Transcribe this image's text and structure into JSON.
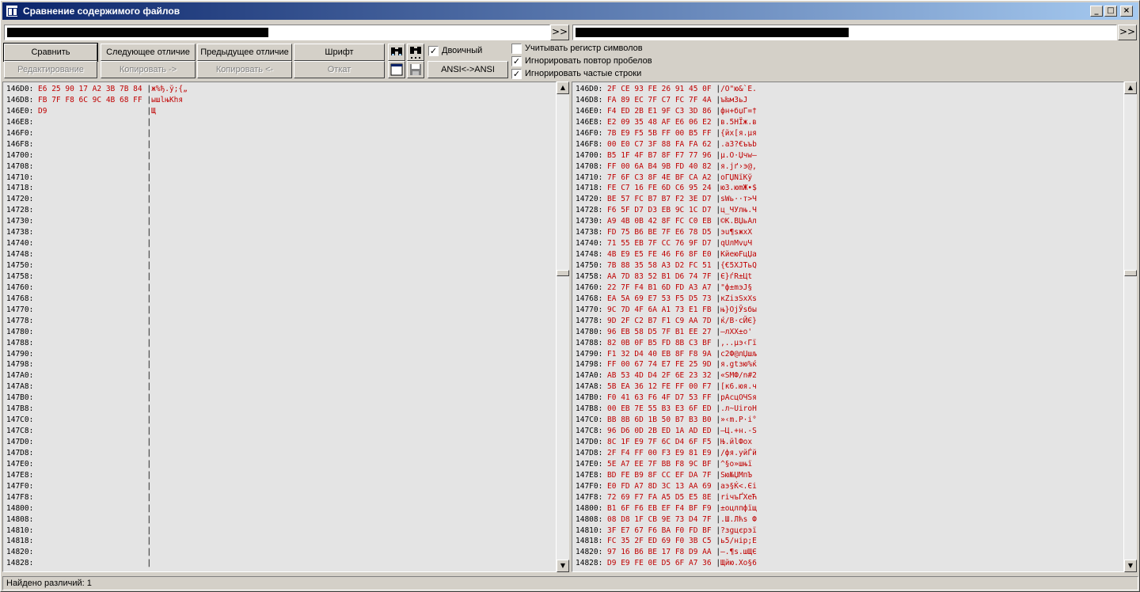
{
  "window": {
    "title": "Сравнение содержимого файлов",
    "minimize": "_",
    "maximize": "□",
    "close": "×"
  },
  "paths": {
    "go_label": ">>"
  },
  "toolbar": {
    "compare": "Сравнить",
    "next_diff": "Следующее отличие",
    "prev_diff": "Предыдущее отличие",
    "font": "Шрифт",
    "edit": "Редактирование",
    "copy_right": "Копировать ->",
    "copy_left": "Копировать <-",
    "rollback": "Откат",
    "encoding": "ANSI<->ANSI",
    "binary": "Двоичный",
    "binary_checked": true
  },
  "options": [
    {
      "label": "Учитывать регистр символов",
      "checked": false
    },
    {
      "label": "Игнорировать повтор пробелов",
      "checked": true
    },
    {
      "label": "Игнорировать частые строки",
      "checked": true
    }
  ],
  "left_pane": [
    {
      "addr": "146D0:",
      "hex": "E6 25 90 17 A2 3B 7B 84",
      "text": "ж%ђ.ў;{„"
    },
    {
      "addr": "146D8:",
      "hex": "FB 7F F8 6C 9C 4B 68 FF",
      "text": "ышlњKhя"
    },
    {
      "addr": "146E0:",
      "hex": "D9",
      "text": "Щ"
    },
    {
      "addr": "146E8:",
      "hex": "",
      "text": ""
    },
    {
      "addr": "146F0:",
      "hex": "",
      "text": ""
    },
    {
      "addr": "146F8:",
      "hex": "",
      "text": ""
    },
    {
      "addr": "14700:",
      "hex": "",
      "text": ""
    },
    {
      "addr": "14708:",
      "hex": "",
      "text": ""
    },
    {
      "addr": "14710:",
      "hex": "",
      "text": ""
    },
    {
      "addr": "14718:",
      "hex": "",
      "text": ""
    },
    {
      "addr": "14720:",
      "hex": "",
      "text": ""
    },
    {
      "addr": "14728:",
      "hex": "",
      "text": ""
    },
    {
      "addr": "14730:",
      "hex": "",
      "text": ""
    },
    {
      "addr": "14738:",
      "hex": "",
      "text": ""
    },
    {
      "addr": "14740:",
      "hex": "",
      "text": ""
    },
    {
      "addr": "14748:",
      "hex": "",
      "text": ""
    },
    {
      "addr": "14750:",
      "hex": "",
      "text": ""
    },
    {
      "addr": "14758:",
      "hex": "",
      "text": ""
    },
    {
      "addr": "14760:",
      "hex": "",
      "text": ""
    },
    {
      "addr": "14768:",
      "hex": "",
      "text": ""
    },
    {
      "addr": "14770:",
      "hex": "",
      "text": ""
    },
    {
      "addr": "14778:",
      "hex": "",
      "text": ""
    },
    {
      "addr": "14780:",
      "hex": "",
      "text": ""
    },
    {
      "addr": "14788:",
      "hex": "",
      "text": ""
    },
    {
      "addr": "14790:",
      "hex": "",
      "text": ""
    },
    {
      "addr": "14798:",
      "hex": "",
      "text": ""
    },
    {
      "addr": "147A0:",
      "hex": "",
      "text": ""
    },
    {
      "addr": "147A8:",
      "hex": "",
      "text": ""
    },
    {
      "addr": "147B0:",
      "hex": "",
      "text": ""
    },
    {
      "addr": "147B8:",
      "hex": "",
      "text": ""
    },
    {
      "addr": "147C0:",
      "hex": "",
      "text": ""
    },
    {
      "addr": "147C8:",
      "hex": "",
      "text": ""
    },
    {
      "addr": "147D0:",
      "hex": "",
      "text": ""
    },
    {
      "addr": "147D8:",
      "hex": "",
      "text": ""
    },
    {
      "addr": "147E0:",
      "hex": "",
      "text": ""
    },
    {
      "addr": "147E8:",
      "hex": "",
      "text": ""
    },
    {
      "addr": "147F0:",
      "hex": "",
      "text": ""
    },
    {
      "addr": "147F8:",
      "hex": "",
      "text": ""
    },
    {
      "addr": "14800:",
      "hex": "",
      "text": ""
    },
    {
      "addr": "14808:",
      "hex": "",
      "text": ""
    },
    {
      "addr": "14810:",
      "hex": "",
      "text": ""
    },
    {
      "addr": "14818:",
      "hex": "",
      "text": ""
    },
    {
      "addr": "14820:",
      "hex": "",
      "text": ""
    },
    {
      "addr": "14828:",
      "hex": "",
      "text": ""
    }
  ],
  "right_pane": [
    {
      "addr": "146D0:",
      "hex": "2F CE 93 FE 26 91 45 0F",
      "text": "/О\"ю&`E."
    },
    {
      "addr": "146D8:",
      "hex": "FA 89 EC 7F C7 FC 7F 4A",
      "text": "ъ‰мЗьJ"
    },
    {
      "addr": "146E0:",
      "hex": "F4 ED 2B E1 9F C3 3D 86",
      "text": "фн+бџГ=†"
    },
    {
      "addr": "146E8:",
      "hex": "E2 09 35 48 AF E6 06 E2",
      "text": "в.5HЇж.в"
    },
    {
      "addr": "146F0:",
      "hex": "7B E9 F5 5B FF 00 B5 FF",
      "text": "{йх[я.µя"
    },
    {
      "addr": "146F8:",
      "hex": "00 E0 C7 3F 88 FA FA 62",
      "text": ".аЗ?€ъъb"
    },
    {
      "addr": "14700:",
      "hex": "B5 1F 4F B7 8F F7 77 96",
      "text": "µ.O·Џчw–"
    },
    {
      "addr": "14708:",
      "hex": "FF 00 6A B4 9B FD 40 82",
      "text": "я.jґ›э@‚"
    },
    {
      "addr": "14710:",
      "hex": "7F 6F C3 8F 4E BF CA A2",
      "text": "oГЏNїКў"
    },
    {
      "addr": "14718:",
      "hex": "FE C7 16 FE 6D C6 95 24",
      "text": "юЗ.юmЖ•$"
    },
    {
      "addr": "14720:",
      "hex": "BE 57 FC B7 B7 F2 3E D7",
      "text": "ѕWь··т>Ч"
    },
    {
      "addr": "14728:",
      "hex": "F6 5F D7 D3 EB 9C 1C D7",
      "text": "ц_ЧУлњ.Ч"
    },
    {
      "addr": "14730:",
      "hex": "A9 4B 0B 42 8F FC C0 EB",
      "text": "©K.BЏьАл"
    },
    {
      "addr": "14738:",
      "hex": "FD 75 B6 BE 7F E6 78 D5",
      "text": "эu¶ѕжxХ"
    },
    {
      "addr": "14740:",
      "hex": "71 55 EB 7F CC 76 9F D7",
      "text": "qUлМvџЧ"
    },
    {
      "addr": "14748:",
      "hex": "4B E9 E5 FE 46 F6 8F E0",
      "text": "KйеюFцЏа"
    },
    {
      "addr": "14750:",
      "hex": "7B 88 35 58 A3 D2 FC 51",
      "text": "{€5XЈТьQ"
    },
    {
      "addr": "14758:",
      "hex": "AA 7D 83 52 B1 D6 74 7F",
      "text": "Є}ѓR±Цt"
    },
    {
      "addr": "14760:",
      "hex": "22 7F F4 B1 6D FD A3 A7",
      "text": "\"ф±mэЈ§"
    },
    {
      "addr": "14768:",
      "hex": "EA 5A 69 E7 53 F5 D5 73",
      "text": "кZiзSхХs"
    },
    {
      "addr": "14770:",
      "hex": "9C 7D 4F 6A A1 73 E1 FB",
      "text": "њ}OjЎsбы"
    },
    {
      "addr": "14778:",
      "hex": "9D 2F C2 B7 F1 C9 AA 7D",
      "text": "ќ/В·сЙЄ}"
    },
    {
      "addr": "14780:",
      "hex": "96 EB 58 D5 7F B1 EE 27",
      "text": "–лXХ±о'"
    },
    {
      "addr": "14788:",
      "hex": "82 0B 0F B5 FD 8B C3 BF",
      "text": "‚..µэ‹Гї"
    },
    {
      "addr": "14790:",
      "hex": "F1 32 D4 40 EB 8F F8 9A",
      "text": "с2Ф@лЏшљ"
    },
    {
      "addr": "14798:",
      "hex": "FF 00 67 74 E7 FE 25 9D",
      "text": "я.gtзю%ќ"
    },
    {
      "addr": "147A0:",
      "hex": "AB 53 4D D4 2F 6E 23 32",
      "text": "«SMФ/n#2"
    },
    {
      "addr": "147A8:",
      "hex": "5B EA 36 12 FE FF 00 F7",
      "text": "[к6.юя.ч"
    },
    {
      "addr": "147B0:",
      "hex": "F0 41 63 F6 4F D7 53 FF",
      "text": "рAcцOЧSя"
    },
    {
      "addr": "147B8:",
      "hex": "00 EB 7E 55 B3 E3 6F ED",
      "text": ".л~UіroН"
    },
    {
      "addr": "147C0:",
      "hex": "BB 8B 6D 1B 50 B7 B3 B0",
      "text": "»‹m.P·і°"
    },
    {
      "addr": "147C8:",
      "hex": "96 D6 0D 2B ED 1A AD ED",
      "text": "–Ц.+н.-S"
    },
    {
      "addr": "147D0:",
      "hex": "8C 1F E9 7F 6C D4 6F F5",
      "text": "Њ.йlФox"
    },
    {
      "addr": "147D8:",
      "hex": "2F F4 FF 00 F3 E9 81 E9",
      "text": "/фя.уйЃй"
    },
    {
      "addr": "147E0:",
      "hex": "5E A7 EE 7F BB F8 9C BF",
      "text": "^§о»шњї"
    },
    {
      "addr": "147E8:",
      "hex": "BD FE B9 8F CC EF DA 7F",
      "text": "Sю№ЏМпЪ"
    },
    {
      "addr": "147F0:",
      "hex": "E0 FD A7 8D 3C 13 AA 69",
      "text": "аэ§Ќ<.Єi"
    },
    {
      "addr": "147F8:",
      "hex": "72 69 F7 FA A5 D5 E5 8E",
      "text": "riчъҐХеЋ"
    },
    {
      "addr": "14800:",
      "hex": "B1 6F F6 EB EF F4 BF F9",
      "text": "±oцлпфїщ"
    },
    {
      "addr": "14808:",
      "hex": "08 D8 1F CB 9E 73 D4 7F",
      "text": ".Ш.Лћs Ф"
    },
    {
      "addr": "14810:",
      "hex": "3F E7 67 F6 BA F0 FD BF",
      "text": "?зgцєрэї"
    },
    {
      "addr": "14818:",
      "hex": "FC 35 2F ED 69 F0 3B C5",
      "text": "ь5/нiр;Е"
    },
    {
      "addr": "14820:",
      "hex": "97 16 B6 BE 17 F8 D9 AA",
      "text": "—.¶ѕ.шЩЄ"
    },
    {
      "addr": "14828:",
      "hex": "D9 E9 FE 0E D5 6F A7 36",
      "text": "Щйю.Хo§6"
    }
  ],
  "status": {
    "text": "Найдено различий: 1"
  }
}
